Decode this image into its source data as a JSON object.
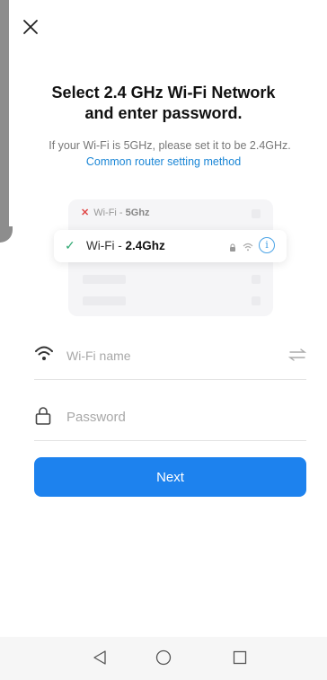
{
  "header": {
    "close_icon": "close-icon"
  },
  "title": {
    "line1": "Select 2.4 GHz Wi-Fi Network",
    "line2": "and enter password."
  },
  "hint": {
    "text": "If your Wi-Fi is 5GHz, please set it to be 2.4GHz.",
    "link": "Common router setting method"
  },
  "illustration": {
    "row_5g": {
      "prefix": "Wi-Fi - ",
      "band": "5Ghz"
    },
    "row_24g": {
      "prefix": "Wi-Fi - ",
      "band": "2.4Ghz"
    },
    "colors": {
      "check": "#2fa872",
      "cross": "#e04848",
      "info": "#4aa3e6"
    }
  },
  "form": {
    "wifi_name": {
      "value": "",
      "placeholder": "Wi-Fi name"
    },
    "password": {
      "value": "",
      "placeholder": "Password"
    }
  },
  "next_button": {
    "label": "Next",
    "color": "#1d82ee"
  },
  "navbar": {
    "icons": [
      "back-triangle-icon",
      "home-circle-icon",
      "recents-square-icon"
    ]
  }
}
